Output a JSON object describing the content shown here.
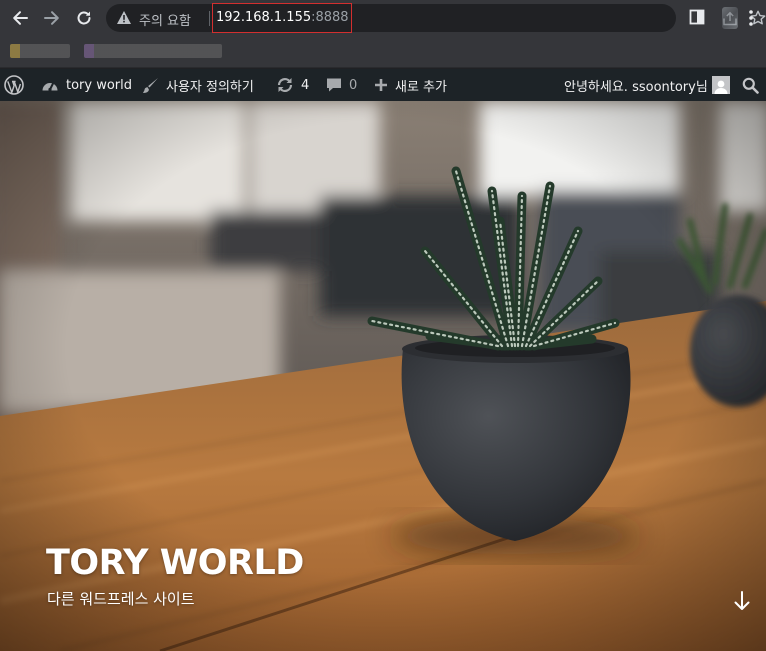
{
  "browser": {
    "security_warning": "주의 요함",
    "url_host": "192.168.1.155",
    "url_port": ":8888",
    "icons": [
      "back-icon",
      "forward-icon",
      "reload-icon",
      "warning-icon",
      "share-icon",
      "star-icon",
      "side-panel-icon",
      "profile-icon",
      "menu-icon"
    ]
  },
  "admin_bar": {
    "site_name": "tory world",
    "customize": "사용자 정의하기",
    "updates_count": "4",
    "comments_count": "0",
    "new_content": "새로 추가",
    "greeting": "안녕하세요. ssoontory님"
  },
  "hero": {
    "site_title": "TORY WORLD",
    "site_description": "다른 워드프레스 사이트"
  },
  "colors": {
    "toolbar": "#35363a",
    "omnibox": "#202124",
    "admin_bar": "#1d2327",
    "url_highlight_border": "#d32f2f"
  }
}
